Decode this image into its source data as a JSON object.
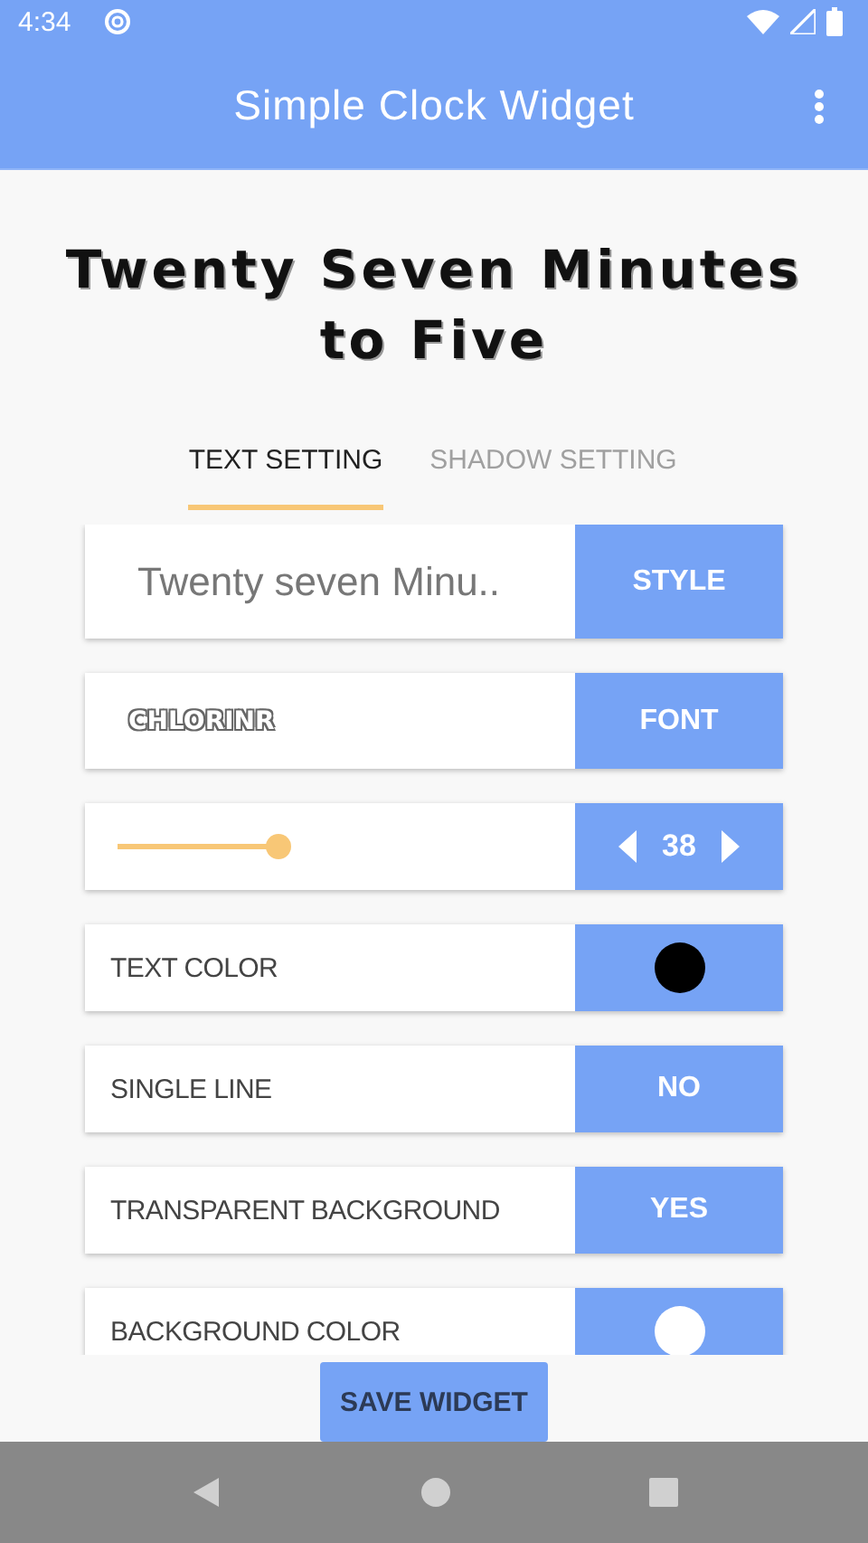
{
  "status_bar": {
    "time": "4:34"
  },
  "app_bar": {
    "title": "Simple Clock Widget"
  },
  "preview": {
    "text": "Twenty Seven Minutes to Five"
  },
  "tabs": [
    {
      "label": "TEXT SETTING",
      "selected": true
    },
    {
      "label": "SHADOW SETTING",
      "selected": false
    }
  ],
  "settings": [
    {
      "kind": "text",
      "value": "Twenty seven Minu..",
      "button": "STYLE"
    },
    {
      "kind": "font",
      "value": "CHLORINR",
      "button": "FONT"
    },
    {
      "kind": "size",
      "button": "38"
    },
    {
      "kind": "color",
      "label": "TEXT COLOR",
      "color": "#000000"
    },
    {
      "kind": "option",
      "label": "SINGLE LINE",
      "button": "NO"
    },
    {
      "kind": "option",
      "label": "TRANSPARENT BACKGROUND",
      "button": "YES"
    },
    {
      "kind": "color",
      "label": "BACKGROUND COLOR",
      "color": "#ffffff"
    }
  ],
  "save_button": "SAVE WIDGET"
}
